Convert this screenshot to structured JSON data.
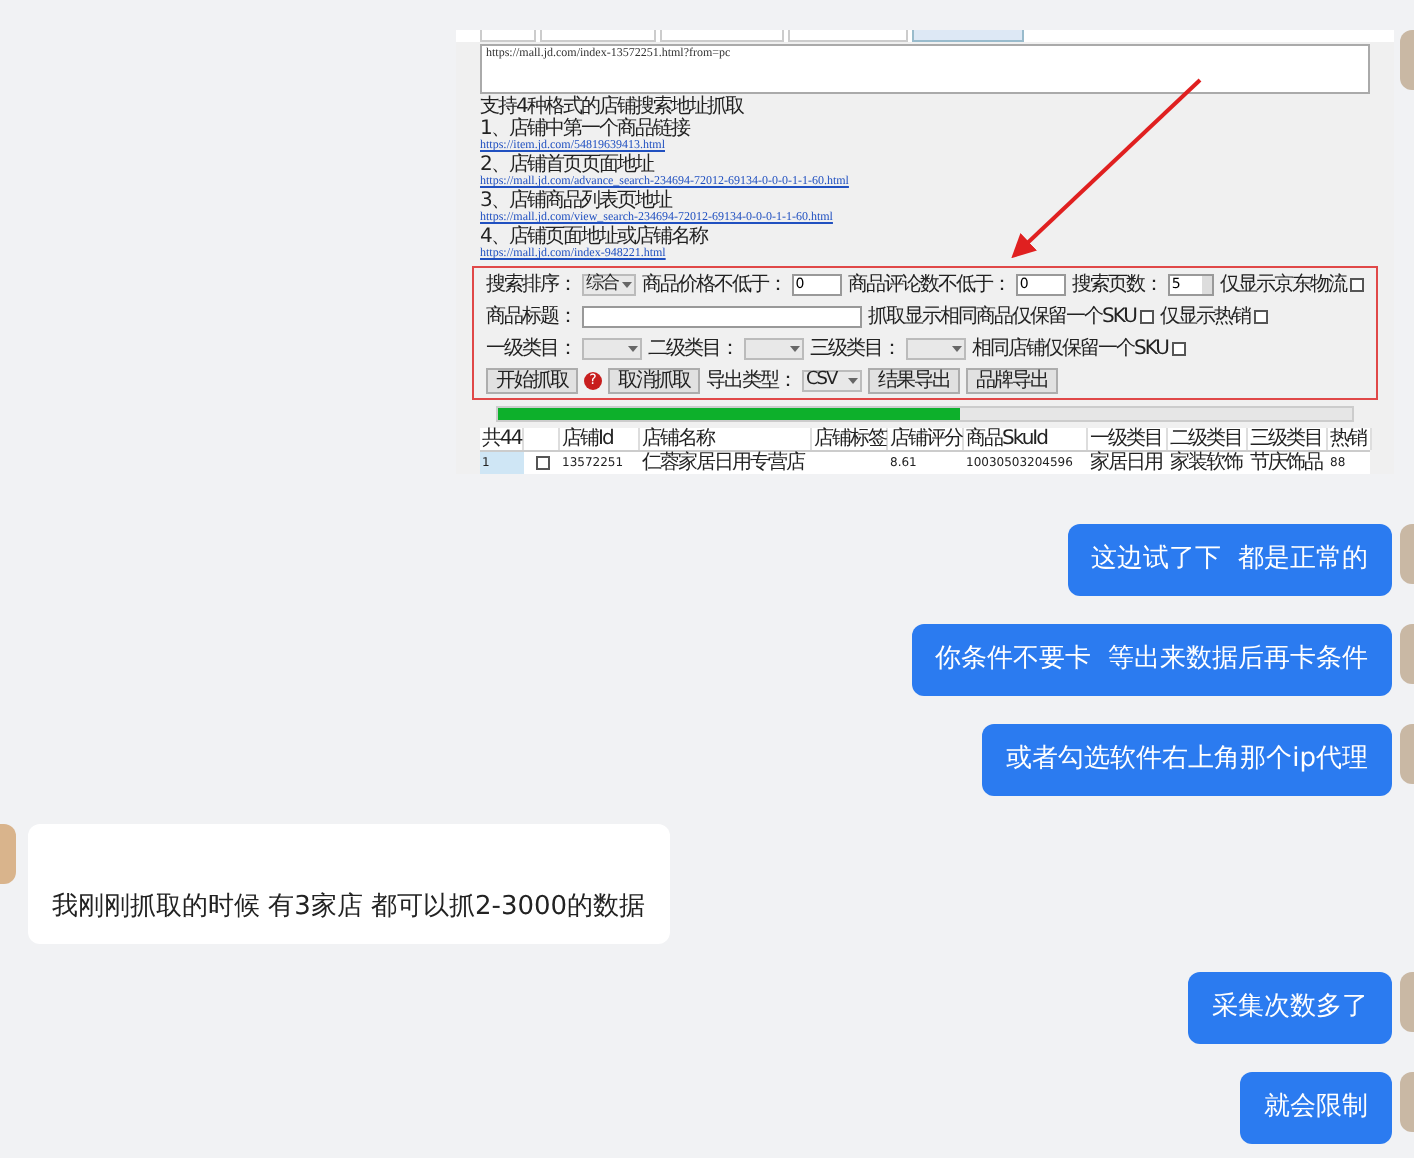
{
  "shared_screenshot": {
    "url_input": "https://mall.jd.com/index-13572251.html?from=pc",
    "instructions": [
      {
        "kind": "text",
        "text": "支持4种格式的店铺搜索地址抓取"
      },
      {
        "kind": "text",
        "text": "1、店铺中第一个商品链接"
      },
      {
        "kind": "link",
        "text": "https://item.jd.com/54819639413.html"
      },
      {
        "kind": "text",
        "text": "2、店铺首页页面地址"
      },
      {
        "kind": "link",
        "text": "https://mall.jd.com/advance_search-234694-72012-69134-0-0-0-1-1-60.html"
      },
      {
        "kind": "text",
        "text": "3、店铺商品列表页地址"
      },
      {
        "kind": "link",
        "text": "https://mall.jd.com/view_search-234694-72012-69134-0-0-0-1-1-60.html"
      },
      {
        "kind": "text",
        "text": "4、店铺页面地址或店铺名称"
      },
      {
        "kind": "link",
        "text": "https://mall.jd.com/index-948221.html"
      }
    ],
    "form_rows": [
      [
        {
          "kind": "label",
          "text": "搜索排序："
        },
        {
          "kind": "select",
          "value": "综合"
        },
        {
          "kind": "label",
          "text": "商品价格不低于："
        },
        {
          "kind": "input",
          "value": "0"
        },
        {
          "kind": "label",
          "text": "商品评论数不低于："
        },
        {
          "kind": "input",
          "value": "0"
        },
        {
          "kind": "label",
          "text": "搜索页数："
        },
        {
          "kind": "spinner",
          "value": "5"
        },
        {
          "kind": "checkbox",
          "label": "仅显示京东物流",
          "checked": false
        }
      ],
      [
        {
          "kind": "label",
          "text": "商品标题："
        },
        {
          "kind": "wideinput"
        },
        {
          "kind": "checkbox",
          "label": "抓取显示相同商品仅保留一个SKU",
          "checked": false
        },
        {
          "kind": "checkbox",
          "label": "仅显示热销",
          "checked": false
        }
      ],
      [
        {
          "kind": "label",
          "text": "一级类目："
        },
        {
          "kind": "select"
        },
        {
          "kind": "label",
          "text": "二级类目："
        },
        {
          "kind": "select"
        },
        {
          "kind": "label",
          "text": "三级类目："
        },
        {
          "kind": "select"
        },
        {
          "kind": "checkbox",
          "label": "相同店铺仅保留一个SKU",
          "checked": false
        }
      ],
      [
        {
          "kind": "button",
          "text": "开始抓取"
        },
        {
          "kind": "help",
          "text": "?"
        },
        {
          "kind": "button",
          "text": "取消抓取"
        },
        {
          "kind": "label",
          "text": "导出类型："
        },
        {
          "kind": "select",
          "value": "CSV"
        },
        {
          "kind": "button",
          "text": "结果导出"
        },
        {
          "kind": "button",
          "text": "品牌导出"
        }
      ]
    ],
    "progress": {
      "level": 0.54
    },
    "table": {
      "columns": [
        "共44",
        "",
        "店铺Id",
        "店铺名称",
        "店铺标签",
        "店铺评分",
        "商品SkuId",
        "一级类目",
        "二级类目",
        "三级类目",
        "热销"
      ],
      "rows": [
        {
          "checked": false,
          "cells": [
            "1",
            "",
            "13572251",
            "仁蓉家居日用专营店",
            "",
            "8.61",
            "10030503204596",
            "家居日用",
            "家装软饰",
            "节庆饰品",
            "88"
          ]
        }
      ]
    }
  },
  "messages": [
    {
      "kind": "sent",
      "text": "这边试了下  都是正常的"
    },
    {
      "kind": "sent",
      "text": "你条件不要卡  等出来数据后再卡条件"
    },
    {
      "kind": "sent",
      "text": "或者勾选软件右上角那个ip代理"
    },
    {
      "kind": "received",
      "text": "我刚刚抓取的时候 有3家店 都可以抓2-3000的数据"
    },
    {
      "kind": "sent",
      "text": "采集次数多了"
    },
    {
      "kind": "sent",
      "text": "就会限制"
    }
  ]
}
